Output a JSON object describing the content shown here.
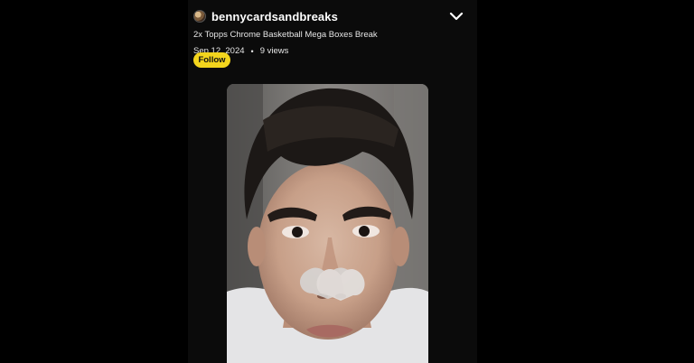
{
  "post": {
    "username": "bennycardsandbreaks",
    "title": "2x Topps Chrome Basketball Mega Boxes Break",
    "date": "Sep 12, 2024",
    "separator": "•",
    "views": "9 views",
    "follow_label": "Follow"
  },
  "icons": {
    "collapse": "chevron-down-icon",
    "avatar": "avatar",
    "reaction": "hearts-icon"
  },
  "colors": {
    "background": "#000000",
    "follow_button": "#f3d51d",
    "text": "#ffffff"
  }
}
